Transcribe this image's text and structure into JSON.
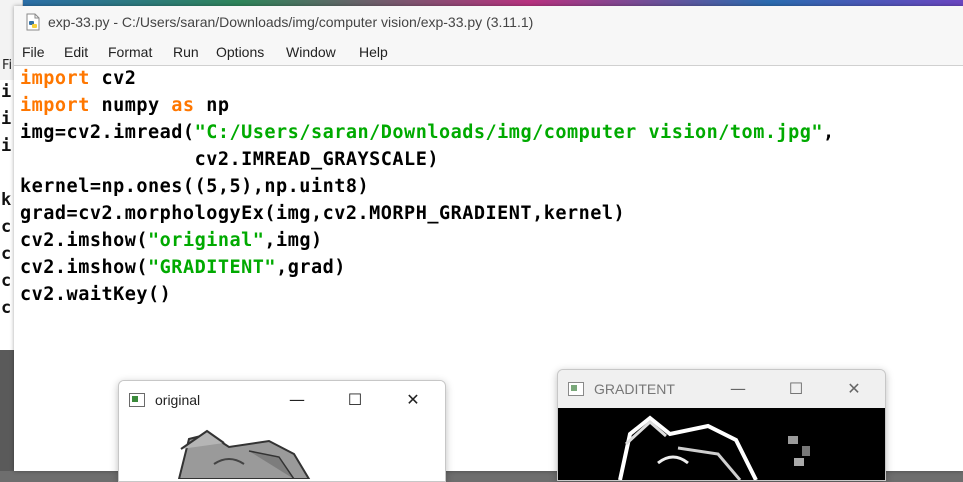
{
  "main_window": {
    "title": "exp-33.py - C:/Users/saran/Downloads/img/computer vision/exp-33.py (3.11.1)",
    "menu": [
      "File",
      "Edit",
      "Format",
      "Run",
      "Options",
      "Window",
      "Help"
    ]
  },
  "code_lines": [
    [
      {
        "t": "import",
        "c": "kw"
      },
      {
        "t": " cv2",
        "c": ""
      }
    ],
    [
      {
        "t": "import",
        "c": "kw"
      },
      {
        "t": " numpy ",
        "c": ""
      },
      {
        "t": "as",
        "c": "kw"
      },
      {
        "t": " np",
        "c": ""
      }
    ],
    [
      {
        "t": "img=cv2.imread(",
        "c": ""
      },
      {
        "t": "\"C:/Users/saran/Downloads/img/computer vision/tom.jpg\"",
        "c": "str"
      },
      {
        "t": ",",
        "c": ""
      }
    ],
    [
      {
        "t": "               cv2.IMREAD_GRAYSCALE)",
        "c": ""
      }
    ],
    [
      {
        "t": "kernel=np.ones((5,5),np.uint8)",
        "c": ""
      }
    ],
    [
      {
        "t": "grad=cv2.morphologyEx(img,cv2.MORPH_GRADIENT,kernel)",
        "c": ""
      }
    ],
    [
      {
        "t": "cv2.imshow(",
        "c": ""
      },
      {
        "t": "\"original\"",
        "c": "str"
      },
      {
        "t": ",img)",
        "c": ""
      }
    ],
    [
      {
        "t": "cv2.imshow(",
        "c": ""
      },
      {
        "t": "\"GRADITENT\"",
        "c": "str"
      },
      {
        "t": ",grad)",
        "c": ""
      }
    ],
    [
      {
        "t": "cv2.waitKey()",
        "c": ""
      }
    ]
  ],
  "background_window": {
    "menu_fragment": "Fi",
    "code_fragments": [
      "i",
      "i",
      "i",
      "",
      "k",
      "c",
      "c",
      "c",
      "c"
    ]
  },
  "cv_windows": {
    "original": {
      "title": "original",
      "minimize": "—",
      "maximize": "☐",
      "close": "✕"
    },
    "gradient": {
      "title": "GRADITENT",
      "minimize": "—",
      "maximize": "☐",
      "close": "✕"
    }
  },
  "colors": {
    "keyword": "#ff7700",
    "string": "#00aa00",
    "text": "#000000"
  }
}
